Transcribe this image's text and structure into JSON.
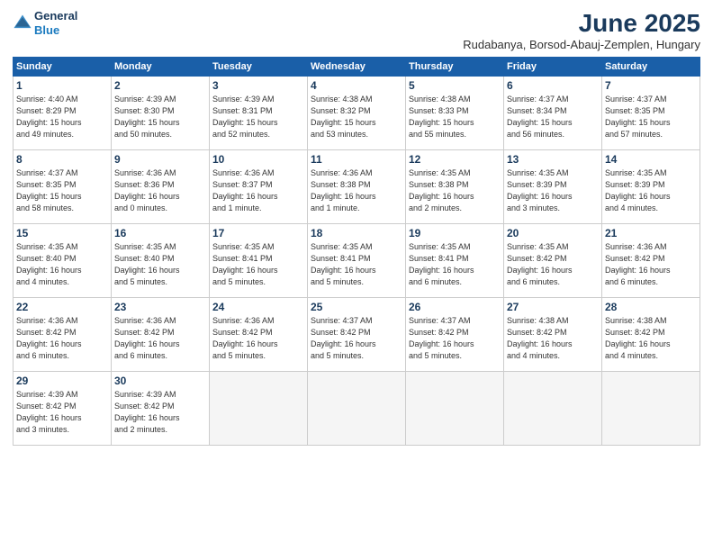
{
  "header": {
    "logo_line1": "General",
    "logo_line2": "Blue",
    "month_title": "June 2025",
    "location": "Rudabanya, Borsod-Abauj-Zemplen, Hungary"
  },
  "weekdays": [
    "Sunday",
    "Monday",
    "Tuesday",
    "Wednesday",
    "Thursday",
    "Friday",
    "Saturday"
  ],
  "weeks": [
    [
      {
        "day": "1",
        "sunrise": "4:40 AM",
        "sunset": "8:29 PM",
        "daylight": "15 hours and 49 minutes."
      },
      {
        "day": "2",
        "sunrise": "4:39 AM",
        "sunset": "8:30 PM",
        "daylight": "15 hours and 50 minutes."
      },
      {
        "day": "3",
        "sunrise": "4:39 AM",
        "sunset": "8:31 PM",
        "daylight": "15 hours and 52 minutes."
      },
      {
        "day": "4",
        "sunrise": "4:38 AM",
        "sunset": "8:32 PM",
        "daylight": "15 hours and 53 minutes."
      },
      {
        "day": "5",
        "sunrise": "4:38 AM",
        "sunset": "8:33 PM",
        "daylight": "15 hours and 55 minutes."
      },
      {
        "day": "6",
        "sunrise": "4:37 AM",
        "sunset": "8:34 PM",
        "daylight": "15 hours and 56 minutes."
      },
      {
        "day": "7",
        "sunrise": "4:37 AM",
        "sunset": "8:35 PM",
        "daylight": "15 hours and 57 minutes."
      }
    ],
    [
      {
        "day": "8",
        "sunrise": "4:37 AM",
        "sunset": "8:35 PM",
        "daylight": "15 hours and 58 minutes."
      },
      {
        "day": "9",
        "sunrise": "4:36 AM",
        "sunset": "8:36 PM",
        "daylight": "16 hours and 0 minutes."
      },
      {
        "day": "10",
        "sunrise": "4:36 AM",
        "sunset": "8:37 PM",
        "daylight": "16 hours and 1 minute."
      },
      {
        "day": "11",
        "sunrise": "4:36 AM",
        "sunset": "8:38 PM",
        "daylight": "16 hours and 1 minute."
      },
      {
        "day": "12",
        "sunrise": "4:35 AM",
        "sunset": "8:38 PM",
        "daylight": "16 hours and 2 minutes."
      },
      {
        "day": "13",
        "sunrise": "4:35 AM",
        "sunset": "8:39 PM",
        "daylight": "16 hours and 3 minutes."
      },
      {
        "day": "14",
        "sunrise": "4:35 AM",
        "sunset": "8:39 PM",
        "daylight": "16 hours and 4 minutes."
      }
    ],
    [
      {
        "day": "15",
        "sunrise": "4:35 AM",
        "sunset": "8:40 PM",
        "daylight": "16 hours and 4 minutes."
      },
      {
        "day": "16",
        "sunrise": "4:35 AM",
        "sunset": "8:40 PM",
        "daylight": "16 hours and 5 minutes."
      },
      {
        "day": "17",
        "sunrise": "4:35 AM",
        "sunset": "8:41 PM",
        "daylight": "16 hours and 5 minutes."
      },
      {
        "day": "18",
        "sunrise": "4:35 AM",
        "sunset": "8:41 PM",
        "daylight": "16 hours and 5 minutes."
      },
      {
        "day": "19",
        "sunrise": "4:35 AM",
        "sunset": "8:41 PM",
        "daylight": "16 hours and 6 minutes."
      },
      {
        "day": "20",
        "sunrise": "4:35 AM",
        "sunset": "8:42 PM",
        "daylight": "16 hours and 6 minutes."
      },
      {
        "day": "21",
        "sunrise": "4:36 AM",
        "sunset": "8:42 PM",
        "daylight": "16 hours and 6 minutes."
      }
    ],
    [
      {
        "day": "22",
        "sunrise": "4:36 AM",
        "sunset": "8:42 PM",
        "daylight": "16 hours and 6 minutes."
      },
      {
        "day": "23",
        "sunrise": "4:36 AM",
        "sunset": "8:42 PM",
        "daylight": "16 hours and 6 minutes."
      },
      {
        "day": "24",
        "sunrise": "4:36 AM",
        "sunset": "8:42 PM",
        "daylight": "16 hours and 5 minutes."
      },
      {
        "day": "25",
        "sunrise": "4:37 AM",
        "sunset": "8:42 PM",
        "daylight": "16 hours and 5 minutes."
      },
      {
        "day": "26",
        "sunrise": "4:37 AM",
        "sunset": "8:42 PM",
        "daylight": "16 hours and 5 minutes."
      },
      {
        "day": "27",
        "sunrise": "4:38 AM",
        "sunset": "8:42 PM",
        "daylight": "16 hours and 4 minutes."
      },
      {
        "day": "28",
        "sunrise": "4:38 AM",
        "sunset": "8:42 PM",
        "daylight": "16 hours and 4 minutes."
      }
    ],
    [
      {
        "day": "29",
        "sunrise": "4:39 AM",
        "sunset": "8:42 PM",
        "daylight": "16 hours and 3 minutes."
      },
      {
        "day": "30",
        "sunrise": "4:39 AM",
        "sunset": "8:42 PM",
        "daylight": "16 hours and 2 minutes."
      },
      null,
      null,
      null,
      null,
      null
    ]
  ]
}
